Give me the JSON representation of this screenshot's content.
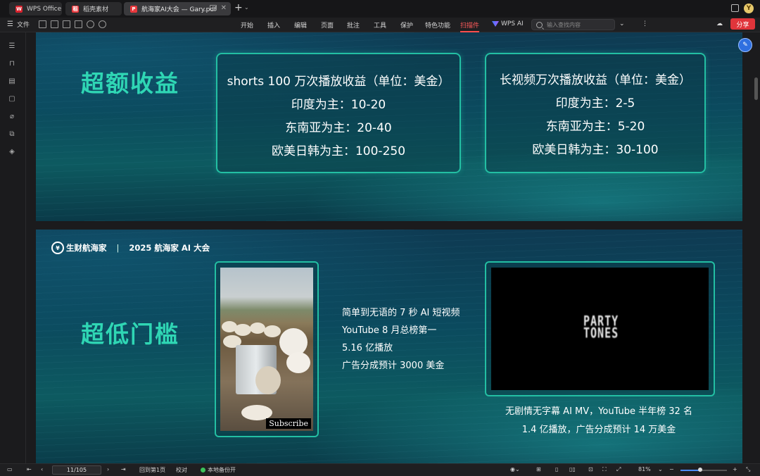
{
  "tabs": [
    {
      "label": "WPS Office",
      "icon": "wps-logo-icon"
    },
    {
      "label": "稻壳素材",
      "icon": "docer-icon"
    },
    {
      "label": "航海家AI大会 — Gary.pdf",
      "icon": "pdf-icon"
    }
  ],
  "toolbar": {
    "file_label": "文件",
    "menus": [
      "开始",
      "插入",
      "编辑",
      "页面",
      "批注",
      "工具",
      "保护",
      "特色功能",
      "扫描件"
    ],
    "active_menu": "扫描件",
    "wps_ai": "WPS AI",
    "search_placeholder": "输入查找内容",
    "share_label": "分享",
    "user_initial": "Y"
  },
  "slide1": {
    "heading": "超额收益",
    "panel_left": {
      "title": "shorts 100 万次播放收益（单位：美金）",
      "lines": [
        "印度为主：10-20",
        "东南亚为主：20-40",
        "欧美日韩为主：100-250"
      ]
    },
    "panel_right": {
      "title": "长视频万次播放收益（单位：美金）",
      "lines": [
        "印度为主：2-5",
        "东南亚为主：5-20",
        "欧美日韩为主：30-100"
      ]
    }
  },
  "slide2": {
    "brand_name": "生财航海家",
    "brand_sep": "|",
    "event": "2025 航海家 AI 大会",
    "heading": "超低门槛",
    "image_caption": "Subscribe",
    "mid_lines": [
      "简单到无语的 7 秒 AI 短视频",
      "YouTube 8 月总榜第一",
      "5.16 亿播放",
      "广告分成预计 3000 美金"
    ],
    "video_text_line1": "PARTY",
    "video_text_line2": "TONES",
    "caption_lines": [
      "无剧情无字幕 AI MV，YouTube 半年榜 32 名",
      "1.4 亿播放，广告分成预计 14 万美金"
    ]
  },
  "statusbar": {
    "page_value": "11/105",
    "back_first": "回到第1页",
    "proofread": "校对",
    "backup": "本地备份开",
    "zoom": "81%",
    "zoom_fraction": 0.42
  },
  "colors": {
    "accent_teal": "#2fd6b4",
    "share_red": "#e0353b",
    "active_menu_red": "#ff5b5b"
  }
}
